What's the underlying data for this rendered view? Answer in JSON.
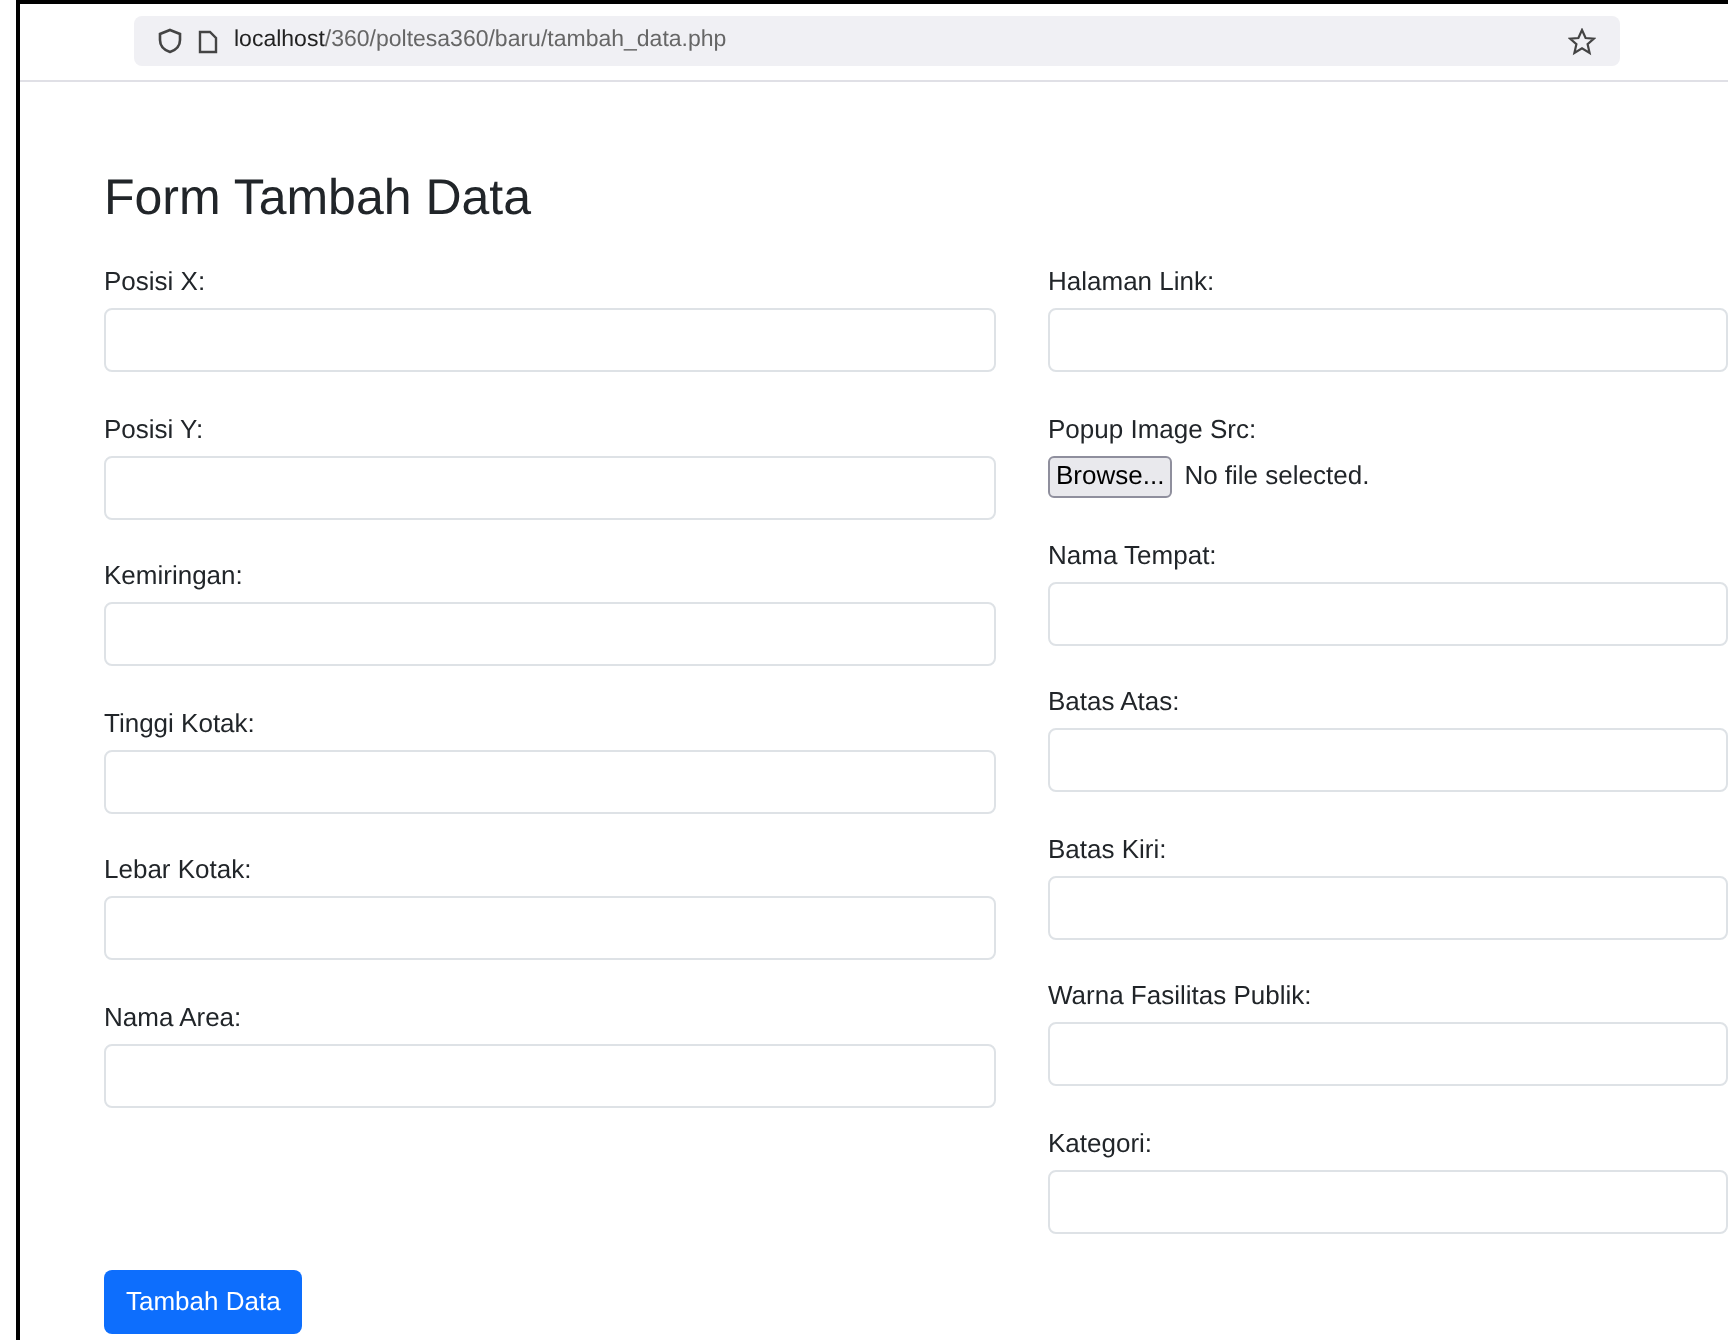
{
  "browser": {
    "url_host": "localhost",
    "url_path": "/360/poltesa360/baru/tambah_data.php"
  },
  "form": {
    "title": "Form Tambah Data",
    "left_fields": [
      {
        "kind": "text",
        "label": "Posisi X:"
      },
      {
        "kind": "text",
        "label": "Posisi Y:"
      },
      {
        "kind": "text",
        "label": "Kemiringan:"
      },
      {
        "kind": "text",
        "label": "Tinggi Kotak:"
      },
      {
        "kind": "text",
        "label": "Lebar Kotak:"
      },
      {
        "kind": "text",
        "label": "Nama Area:"
      }
    ],
    "right_fields": [
      {
        "kind": "text",
        "label": "Halaman Link:"
      },
      {
        "kind": "file",
        "label": "Popup Image Src:",
        "button": "Browse...",
        "status": "No file selected."
      },
      {
        "kind": "text",
        "label": "Nama Tempat:"
      },
      {
        "kind": "text",
        "label": "Batas Atas:"
      },
      {
        "kind": "text",
        "label": "Batas Kiri:"
      },
      {
        "kind": "text",
        "label": "Warna Fasilitas Publik:"
      },
      {
        "kind": "text",
        "label": "Kategori:"
      }
    ],
    "submit": "Tambah Data"
  }
}
